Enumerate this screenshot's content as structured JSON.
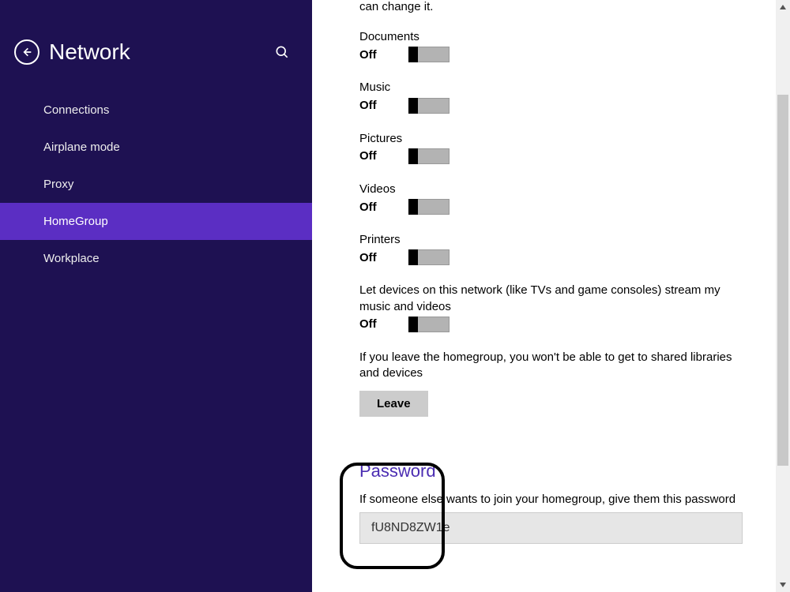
{
  "sidebar": {
    "title": "Network",
    "items": [
      {
        "label": "Connections"
      },
      {
        "label": "Airplane mode"
      },
      {
        "label": "Proxy"
      },
      {
        "label": "HomeGroup"
      },
      {
        "label": "Workplace"
      }
    ],
    "active_index": 3
  },
  "intro_tail": "can change it.",
  "toggles": {
    "documents": {
      "label": "Documents",
      "state": "Off"
    },
    "music": {
      "label": "Music",
      "state": "Off"
    },
    "pictures": {
      "label": "Pictures",
      "state": "Off"
    },
    "videos": {
      "label": "Videos",
      "state": "Off"
    },
    "printers": {
      "label": "Printers",
      "state": "Off"
    },
    "stream": {
      "label": "Let devices on this network (like TVs and game consoles) stream my music and videos",
      "state": "Off"
    }
  },
  "leave": {
    "desc": "If you leave the homegroup, you won't be able to get to shared libraries and devices",
    "button": "Leave"
  },
  "password": {
    "heading": "Password",
    "desc": "If someone else wants to join your homegroup, give them this password",
    "value": "fU8ND8ZW1e"
  }
}
